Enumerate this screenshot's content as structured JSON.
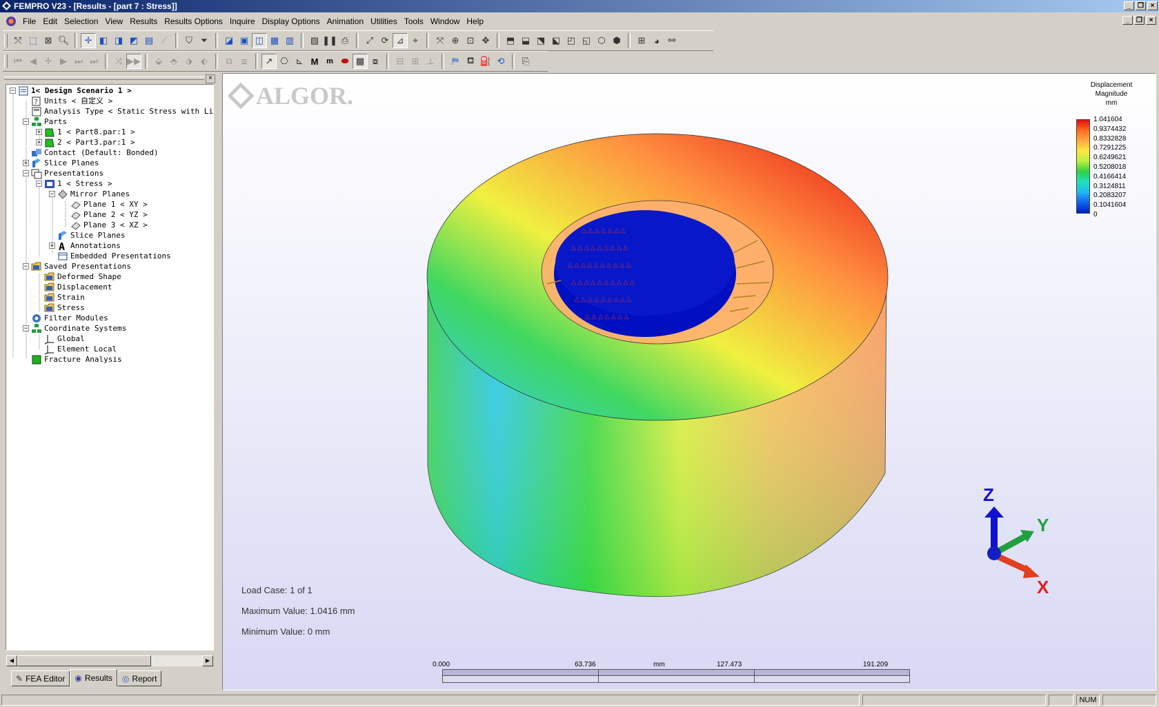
{
  "window": {
    "title": "FEMPRO V23 - [Results - [part 7 : Stress]]"
  },
  "menu": [
    {
      "label": "File"
    },
    {
      "label": "Edit"
    },
    {
      "label": "Selection"
    },
    {
      "label": "View"
    },
    {
      "label": "Results"
    },
    {
      "label": "Results Options"
    },
    {
      "label": "Inquire"
    },
    {
      "label": "Display Options"
    },
    {
      "label": "Animation"
    },
    {
      "label": "Utilities"
    },
    {
      "label": "Tools"
    },
    {
      "label": "Window"
    },
    {
      "label": "Help"
    }
  ],
  "toolbar2": {
    "M_big": "M",
    "m_small": "m"
  },
  "tree": [
    {
      "label": "1< Design Scenario 1 >"
    },
    {
      "label": "Units < 自定义 >"
    },
    {
      "label": "Analysis Type < Static Stress with Line"
    },
    {
      "label": "Parts"
    },
    {
      "label": "1 < Part8.par:1 >"
    },
    {
      "label": "2 < Part3.par:1 >"
    },
    {
      "label": "Contact (Default: Bonded)"
    },
    {
      "label": "Slice Planes"
    },
    {
      "label": "Presentations"
    },
    {
      "label": "1 < Stress >"
    },
    {
      "label": "Mirror Planes"
    },
    {
      "label": "Plane 1 < XY >"
    },
    {
      "label": "Plane 2 < YZ >"
    },
    {
      "label": "Plane 3 < XZ >"
    },
    {
      "label": "Slice Planes"
    },
    {
      "label": "Annotations"
    },
    {
      "label": "Embedded Presentations"
    },
    {
      "label": "Saved Presentations"
    },
    {
      "label": "Deformed Shape"
    },
    {
      "label": "Displacement"
    },
    {
      "label": "Strain"
    },
    {
      "label": "Stress"
    },
    {
      "label": "Filter Modules"
    },
    {
      "label": "Coordinate Systems"
    },
    {
      "label": "Global"
    },
    {
      "label": "Element Local"
    },
    {
      "label": "Fracture Analysis"
    }
  ],
  "tabs": [
    {
      "label": "FEA Editor"
    },
    {
      "label": "Results"
    },
    {
      "label": "Report"
    }
  ],
  "viewport": {
    "logo": "ALGOR.",
    "legend": {
      "title": [
        "Displacement",
        "Magnitude",
        "mm"
      ],
      "values": [
        "1.041604",
        "0.9374432",
        "0.8332828",
        "0.7291225",
        "0.6249621",
        "0.5208018",
        "0.4166414",
        "0.3124811",
        "0.2083207",
        "0.1041604",
        "0"
      ]
    },
    "info": {
      "load_case": "Load Case:  1 of 1",
      "max_value": "Maximum Value: 1.0416 mm",
      "min_value": "Minimum Value: 0 mm"
    },
    "scale": {
      "ticks": [
        "0.000",
        "63.736",
        "mm",
        "127.473",
        "191.209"
      ]
    },
    "triad": {
      "z": "Z",
      "y": "Y",
      "x": "X"
    }
  },
  "status": {
    "num": "NUM"
  }
}
